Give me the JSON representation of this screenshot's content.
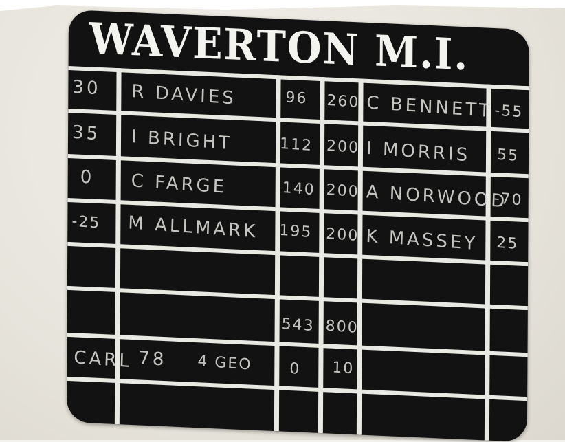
{
  "board": {
    "title": "WAVERTON M.I.",
    "rows": [
      {
        "a": "30",
        "name1": "R DAVIES",
        "s1": "96",
        "s2": "260",
        "name2": "C BENNETT",
        "d": "-55"
      },
      {
        "a": "35",
        "name1": "I BRIGHT",
        "s1": "112",
        "s2": "200",
        "name2": "I MORRIS",
        "d": "55"
      },
      {
        "a": "0",
        "name1": "C FARGE",
        "s1": "140",
        "s2": "200",
        "name2": "A NORWOOD",
        "d": "-70"
      },
      {
        "a": "-25",
        "name1": "M ALLMARK",
        "s1": "195",
        "s2": "200",
        "name2": "K MASSEY",
        "d": "25"
      }
    ],
    "totals": {
      "s1": "543",
      "s2": "800"
    },
    "footer": {
      "a": "CARL",
      "name1": "78",
      "note": "4 GEO",
      "s1": "0",
      "s2": "10"
    }
  }
}
